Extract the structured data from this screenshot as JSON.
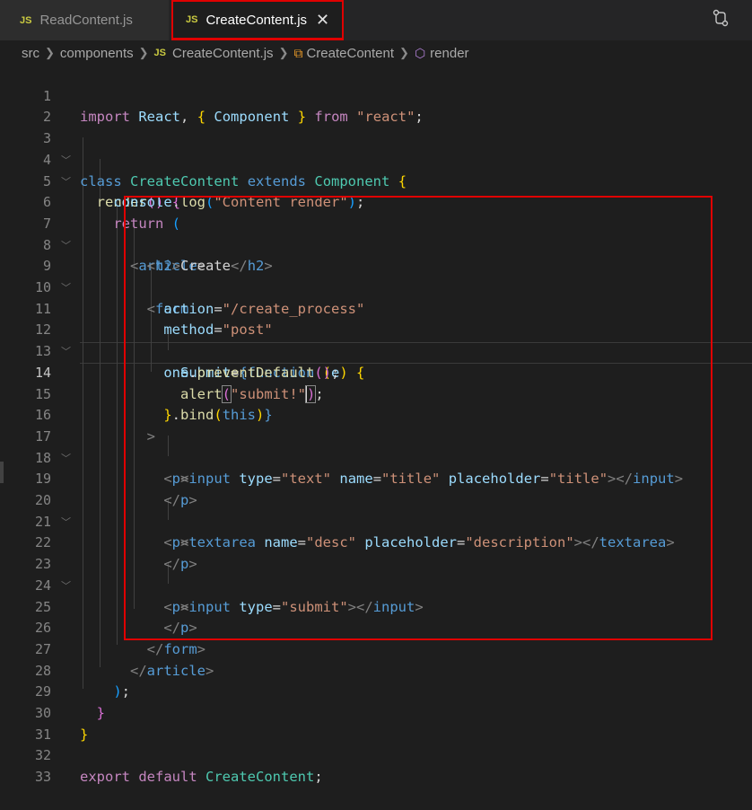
{
  "tabs": [
    {
      "label": "ReadContent.js",
      "icon": "JS",
      "active": false
    },
    {
      "label": "CreateContent.js",
      "icon": "JS",
      "active": true,
      "close": "✕"
    }
  ],
  "breadcrumb": {
    "items": [
      "src",
      "components",
      "CreateContent.js",
      "CreateContent",
      "render"
    ],
    "file_icon": "JS"
  },
  "editor": {
    "language": "javascript",
    "active_line": 14,
    "line_numbers": [
      "1",
      "2",
      "3",
      "4",
      "5",
      "6",
      "7",
      "8",
      "9",
      "10",
      "11",
      "12",
      "13",
      "14",
      "15",
      "16",
      "17",
      "18",
      "19",
      "20",
      "21",
      "22",
      "23",
      "24",
      "25",
      "26",
      "27",
      "28",
      "29",
      "30",
      "31",
      "32",
      "33"
    ],
    "tokens": {
      "import": "import",
      "react_default": "React",
      "component": "Component",
      "from": "from",
      "react_str": "\"react\"",
      "class": "class",
      "class_name": "CreateContent",
      "extends": "extends",
      "render": "render",
      "console": "console",
      "log": "log",
      "log_str": "\"Content render\"",
      "return": "return",
      "article": "article",
      "h2": "h2",
      "h2_text": "Create",
      "form": "form",
      "action": "action",
      "action_val": "\"/create_process\"",
      "method": "method",
      "method_val": "\"post\"",
      "onsubmit": "onSubmit",
      "function": "function",
      "e": "e",
      "prevent": "preventDefault",
      "alert": "alert",
      "alert_str": "\"submit!\"",
      "bind": "bind",
      "this": "this",
      "p": "p",
      "input": "input",
      "type": "type",
      "text_val": "\"text\"",
      "name": "name",
      "title_val": "\"title\"",
      "placeholder": "placeholder",
      "textarea": "textarea",
      "desc_val": "\"desc\"",
      "description_val": "\"description\"",
      "submit_val": "\"submit\"",
      "export": "export",
      "default": "default"
    }
  },
  "colors": {
    "editor_bg": "#1e1e1e",
    "highlight": "#e00000",
    "keyword": "#c586c0",
    "tag": "#569cd6",
    "class": "#4ec9b0",
    "string": "#ce9178",
    "function": "#dcdcaa",
    "variable": "#9cdcfe"
  },
  "icons": [
    "js-file-icon",
    "close-icon",
    "source-control-compare-icon",
    "chevron-right-icon",
    "class-icon",
    "method-cube-icon",
    "fold-chevron-icon"
  ]
}
